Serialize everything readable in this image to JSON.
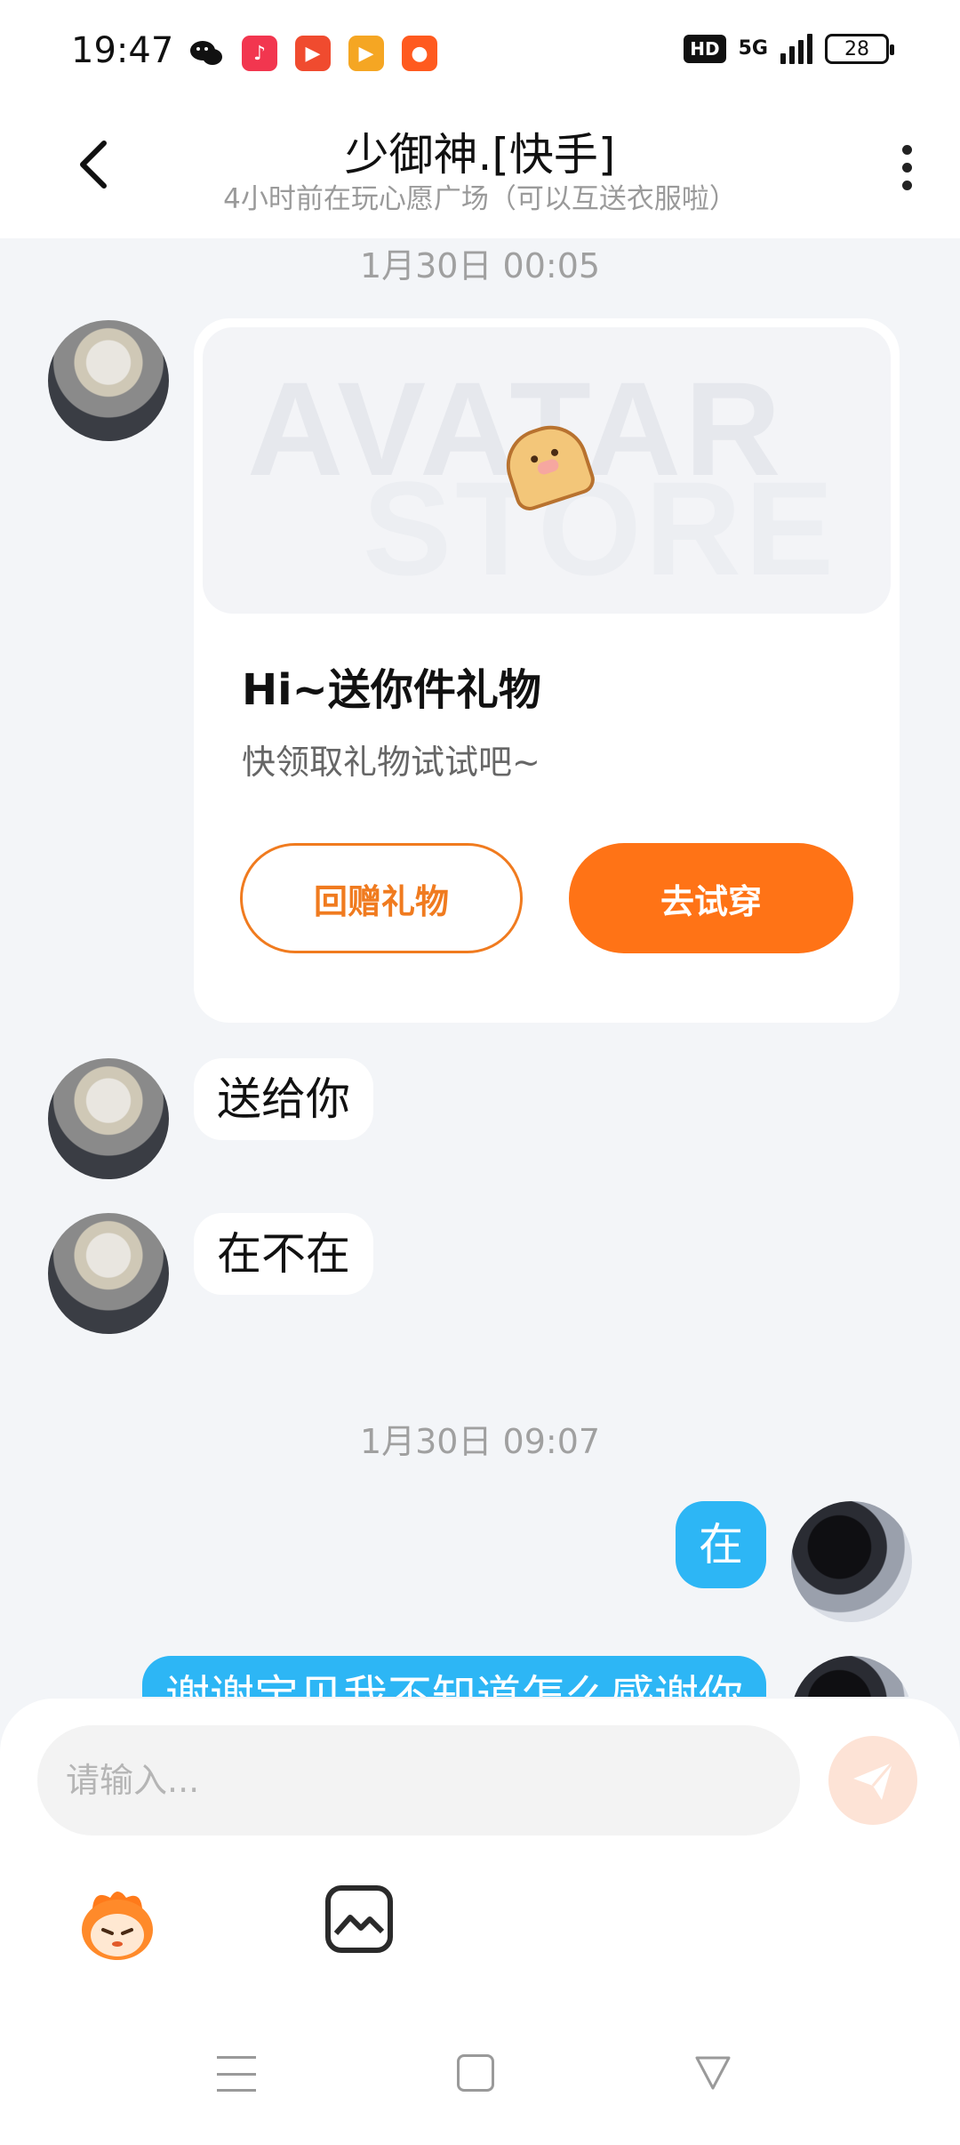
{
  "status_bar": {
    "time": "19:47",
    "network": "5G",
    "battery": "28",
    "hd": "HD"
  },
  "header": {
    "title": "少御神.[快手]",
    "subtitle": "4小时前在玩心愿广场（可以互送衣服啦）"
  },
  "messages": {
    "time_1": "1月30日 00:05",
    "gift_card": {
      "watermark_line1": "AVATAR",
      "watermark_line2": "STORE",
      "title": "Hi~送你件礼物",
      "desc": "快领取礼物试试吧~",
      "return_label": "回赠礼物",
      "try_label": "去试穿"
    },
    "msg_1": "送给你",
    "msg_2": "在不在",
    "time_2": "1月30日 09:07",
    "msg_3": "在",
    "msg_4": "谢谢宝贝我不知道怎么感谢你"
  },
  "input": {
    "placeholder": "请输入..."
  },
  "colors": {
    "accent": "#ff7316",
    "bubble_me": "#2db6f5",
    "background": "#f3f5f8"
  },
  "icons": {
    "back": "chevron-left-icon",
    "more": "more-vertical-icon",
    "send": "send-icon",
    "emoji": "emoji-icon",
    "image": "image-icon"
  }
}
